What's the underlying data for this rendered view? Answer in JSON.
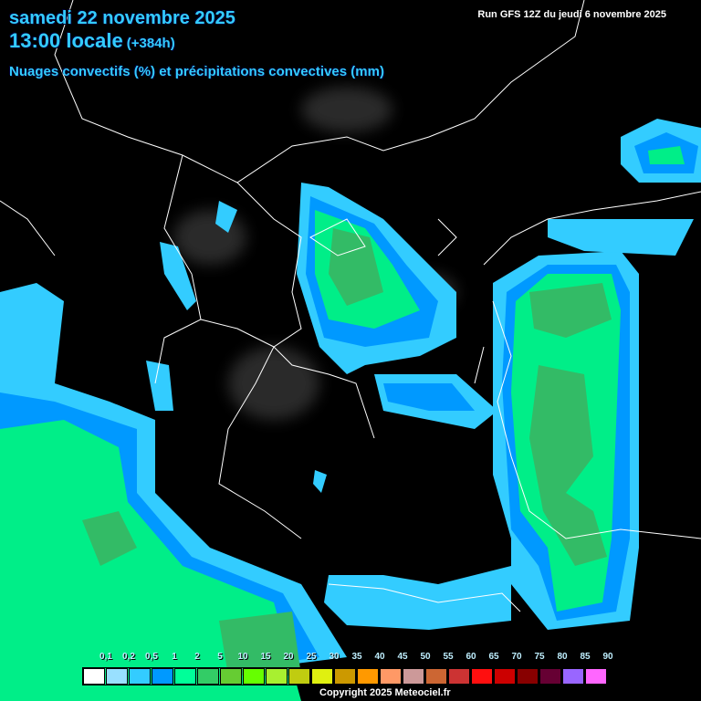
{
  "header": {
    "date": "samedi 22 novembre 2025",
    "time": "13:00 locale",
    "lead": "(+384h)",
    "subtitle": "Nuages convectifs (%) et précipitations convectives (mm)",
    "run": "Run GFS 12Z du jeudi 6 novembre 2025"
  },
  "legend": {
    "labels": [
      "0,1",
      "0,2",
      "0,5",
      "1",
      "2",
      "5",
      "10",
      "15",
      "20",
      "25",
      "30",
      "35",
      "40",
      "45",
      "50",
      "55",
      "60",
      "65",
      "70",
      "75",
      "80",
      "85",
      "90"
    ],
    "colors": [
      "#ffffff",
      "#99e0ff",
      "#33ccff",
      "#0099ff",
      "#00ff99",
      "#33cc66",
      "#66cc33",
      "#66ff00",
      "#a8f030",
      "#c0cc10",
      "#e0f010",
      "#cc9900",
      "#ff9900",
      "#ff9966",
      "#cc9999",
      "#cc6633",
      "#cc3333",
      "#ff0f0f",
      "#cc0000",
      "#880000",
      "#660033",
      "#9966ff",
      "#ff66ff"
    ]
  },
  "copyright": "Copyright 2025 Meteociel.fr",
  "colors": {
    "light_blue": "#33ccff",
    "blue": "#0099ff",
    "green": "#00ee88",
    "dark_green": "#33bb66"
  }
}
